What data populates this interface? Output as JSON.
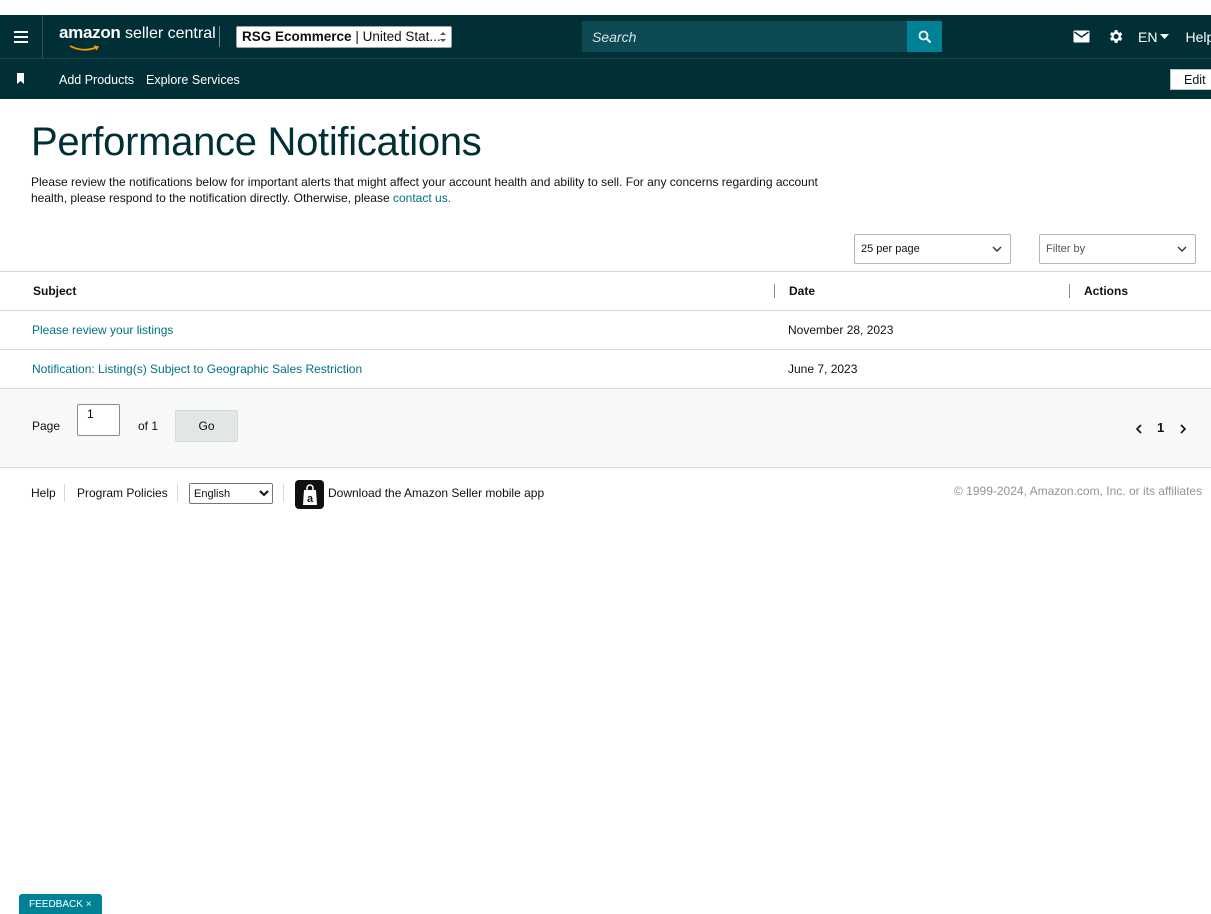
{
  "topbar": {
    "logo_brand": "amazon",
    "logo_rest": " seller central",
    "account_name": "RSG Ecommerce",
    "account_region": " | United Stat...",
    "search_placeholder": "Search",
    "language": "EN",
    "help": "Help"
  },
  "navbar": {
    "items": [
      "Add Products",
      "Explore Services"
    ],
    "edit": "Edit"
  },
  "page": {
    "title": "Performance Notifications",
    "intro": "Please review the notifications below for important alerts that might affect your account health and ability to sell. For any concerns regarding account health, please respond to the notification directly. Otherwise, please ",
    "contact_link": "contact us."
  },
  "controls": {
    "per_page": "25 per page",
    "filter": "Filter by"
  },
  "table": {
    "headers": [
      "Subject",
      "Date",
      "Actions"
    ],
    "rows": [
      {
        "subject": "Please review your listings",
        "date": "November 28, 2023"
      },
      {
        "subject": "Notification: Listing(s) Subject to Geographic Sales Restriction",
        "date": "June 7, 2023"
      }
    ]
  },
  "pager": {
    "label": "Page",
    "value": "1",
    "of": "of 1",
    "go": "Go",
    "current": "1"
  },
  "footer": {
    "help": "Help",
    "policies": "Program Policies",
    "language": "English",
    "app_text": "Download the Amazon Seller mobile app",
    "app_icon_letter": "a",
    "copyright": "© 1999-2024, Amazon.com, Inc. or its affiliates"
  },
  "feedback": {
    "label": "FEEDBACK",
    "close": "×"
  },
  "colors": {
    "header_bg": "#002f36",
    "search_bg": "#0e4a54",
    "accent": "#008296",
    "link": "#007185"
  },
  "icons": [
    "menu-icon",
    "amazon-smile-icon",
    "stepper-icon",
    "search-icon",
    "mail-icon",
    "gear-icon",
    "caret-down-icon",
    "bookmark-icon",
    "chevron-down-icon",
    "chevron-left-icon",
    "chevron-right-icon",
    "amazon-app-icon",
    "close-icon"
  ]
}
